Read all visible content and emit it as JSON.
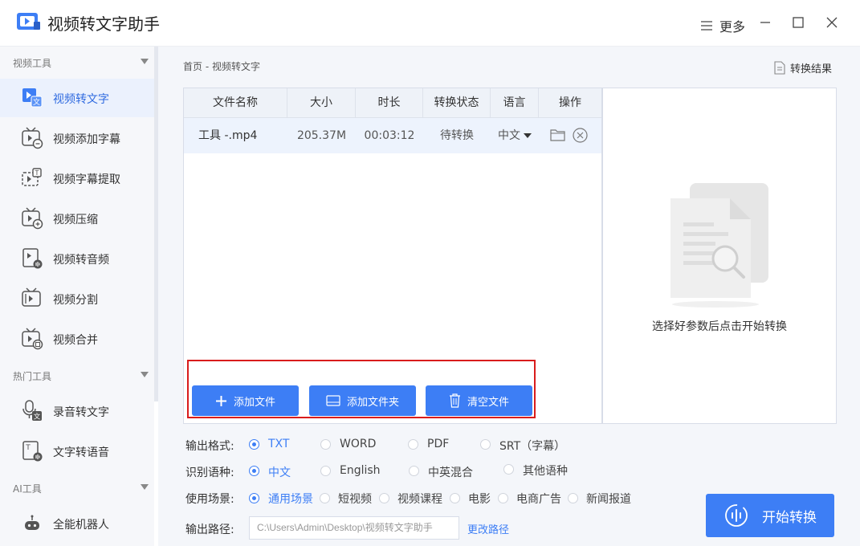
{
  "app": {
    "title": "视频转文字助手",
    "more": "更多"
  },
  "sidebar": {
    "groups": [
      "视频工具",
      "热门工具",
      "AI工具"
    ],
    "items": [
      {
        "label": "视频转文字",
        "icon": "video-to-text-icon"
      },
      {
        "label": "视频添加字幕",
        "icon": "add-subtitle-icon"
      },
      {
        "label": "视频字幕提取",
        "icon": "subtitle-extract-icon"
      },
      {
        "label": "视频压缩",
        "icon": "video-compress-icon"
      },
      {
        "label": "视频转音频",
        "icon": "video-to-audio-icon"
      },
      {
        "label": "视频分割",
        "icon": "video-split-icon"
      },
      {
        "label": "视频合并",
        "icon": "video-merge-icon"
      },
      {
        "label": "录音转文字",
        "icon": "audio-to-text-icon"
      },
      {
        "label": "文字转语音",
        "icon": "text-to-speech-icon"
      },
      {
        "label": "全能机器人",
        "icon": "robot-icon"
      }
    ]
  },
  "breadcrumb": "首页 - 视频转文字",
  "result_link": "转换结果",
  "table": {
    "headers": [
      "文件名称",
      "大小",
      "时长",
      "转换状态",
      "语言",
      "操作"
    ],
    "rows": [
      {
        "name": "工具 -.mp4",
        "size": "205.37M",
        "duration": "00:03:12",
        "status": "待转换",
        "language": "中文"
      }
    ]
  },
  "buttons": {
    "add_file": "添加文件",
    "add_folder": "添加文件夹",
    "clear": "清空文件"
  },
  "preview_hint": "选择好参数后点击开始转换",
  "options": {
    "format_label": "输出格式:",
    "formats": [
      "TXT",
      "WORD",
      "PDF",
      "SRT（字幕）"
    ],
    "format_selected": "TXT",
    "lang_label": "识别语种:",
    "langs": [
      "中文",
      "English",
      "中英混合",
      "其他语种"
    ],
    "lang_selected": "中文",
    "scene_label": "使用场景:",
    "scenes": [
      "通用场景",
      "短视频",
      "视频课程",
      "电影",
      "电商广告",
      "新闻报道"
    ],
    "scene_selected": "通用场景",
    "path_label": "输出路径:",
    "path_value": "C:\\Users\\Admin\\Desktop\\视频转文字助手",
    "change_path": "更改路径"
  },
  "start_button": "开始转换",
  "colors": {
    "accent": "#3d7ef5",
    "highlight_border": "#d91c1c",
    "active_bg": "#ebf1fd"
  }
}
